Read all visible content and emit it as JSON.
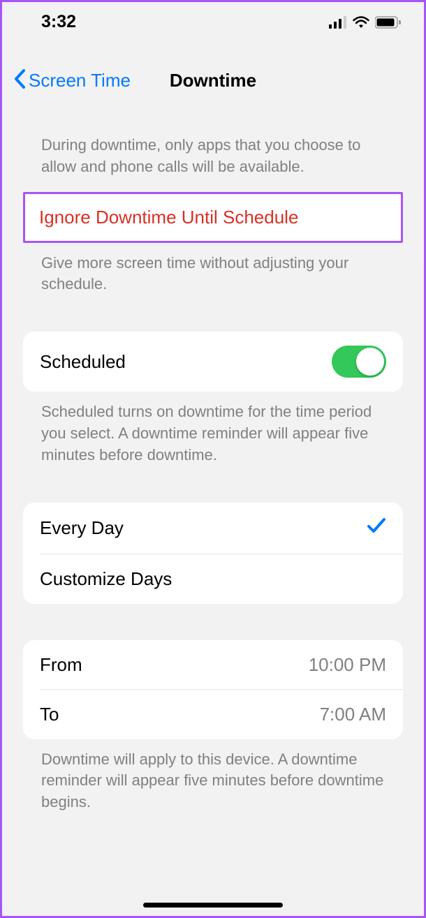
{
  "status": {
    "time": "3:32"
  },
  "nav": {
    "back_label": "Screen Time",
    "title": "Downtime"
  },
  "intro_description": "During downtime, only apps that you choose to allow and phone calls will be available.",
  "ignore": {
    "label": "Ignore Downtime Until Schedule",
    "description": "Give more screen time without adjusting your schedule."
  },
  "scheduled": {
    "label": "Scheduled",
    "enabled": true,
    "description": "Scheduled turns on downtime for the time period you select. A downtime reminder will appear five minutes before downtime."
  },
  "schedule_type": {
    "every_day_label": "Every Day",
    "every_day_selected": true,
    "customize_label": "Customize Days"
  },
  "time_range": {
    "from_label": "From",
    "from_value": "10:00 PM",
    "to_label": "To",
    "to_value": "7:00 AM",
    "description": "Downtime will apply to this device. A downtime reminder will appear five minutes before downtime begins."
  }
}
